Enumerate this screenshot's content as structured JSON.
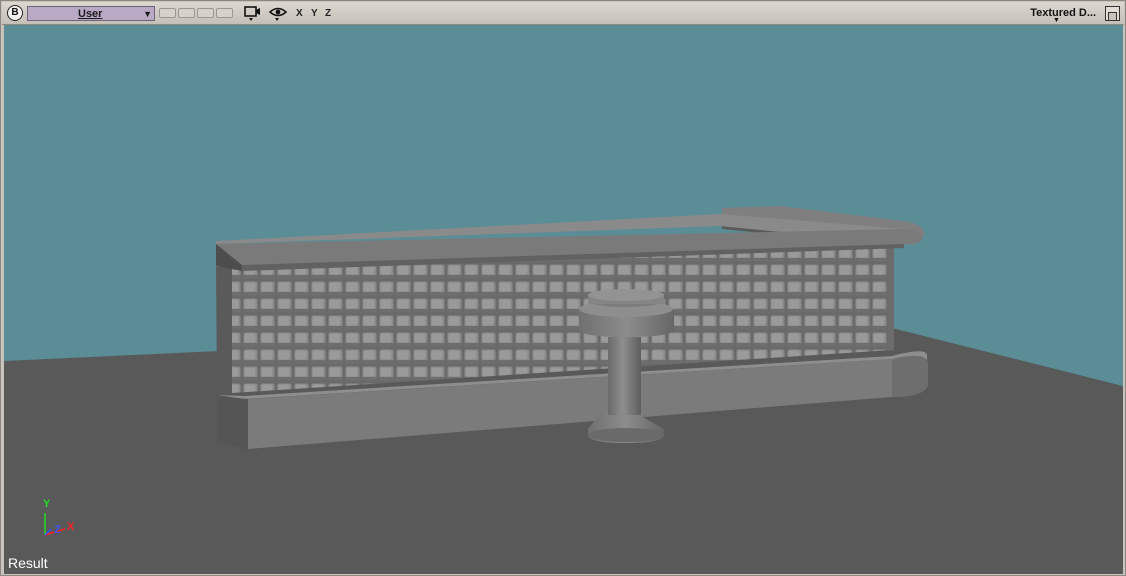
{
  "toolbar": {
    "app_badge": "B",
    "camera": "User",
    "camera_arrow": "▼",
    "axis_x": "X",
    "axis_y": "Y",
    "axis_z": "Z",
    "shading_mode": "Textured D...",
    "shading_arrow": "▼",
    "icons": [
      "camera-icon",
      "eye-icon",
      "single-panel-icon"
    ]
  },
  "viewport": {
    "result_label": "Result",
    "axis_gizmo": {
      "y": "Y",
      "z": "Z",
      "x": "X"
    },
    "colors": {
      "background": "#5a8d96",
      "floor": "#595959",
      "model_surface": "#7a7a7a",
      "model_shadow": "#4e4e4e",
      "axis_x": "#ff2222",
      "axis_y": "#22dd22",
      "axis_z": "#3355ff"
    },
    "objects": [
      "bar-counter",
      "bar-stool"
    ]
  }
}
